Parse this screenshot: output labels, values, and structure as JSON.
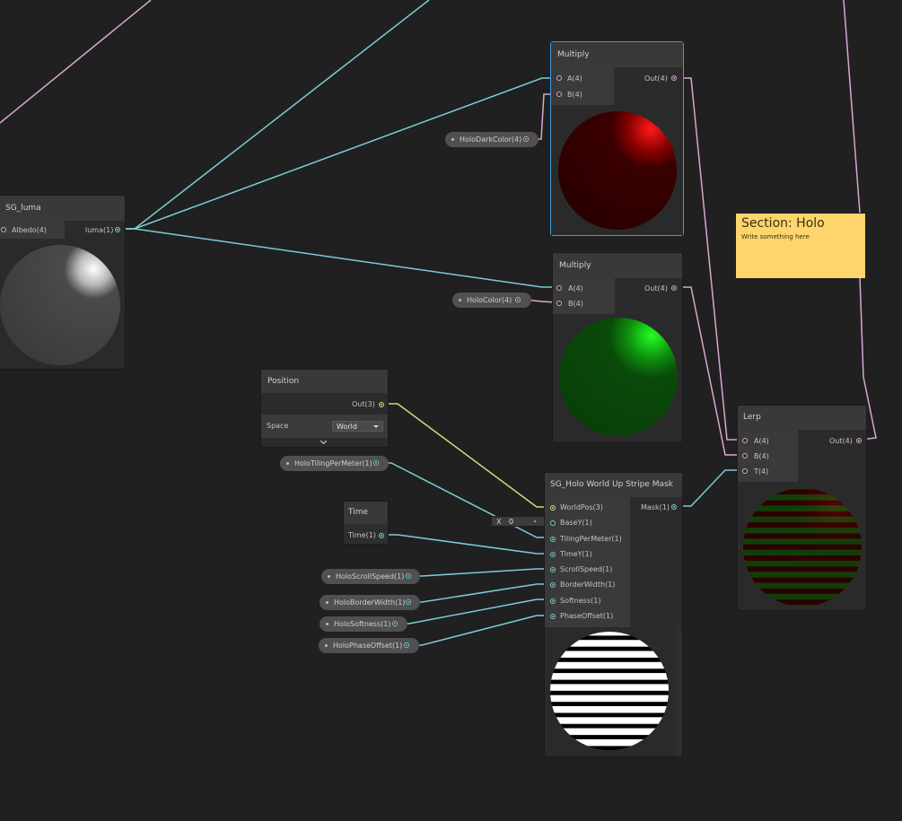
{
  "colors": {
    "background": "#202020",
    "wire_vector4": "#d9a6d3",
    "wire_float": "#7ccbd8",
    "wire_vector3": "#d6d97a",
    "sticky": "#fdd56c",
    "selection": "#3d9ae0"
  },
  "nodes": {
    "sg_luma": {
      "title": "SG_luma",
      "in_albedo": "Albedo(4)",
      "out_luma": "luma(1)"
    },
    "multiply_top": {
      "title": "Multiply",
      "in_a": "A(4)",
      "in_b": "B(4)",
      "out": "Out(4)"
    },
    "multiply_mid": {
      "title": "Multiply",
      "in_a": "A(4)",
      "in_b": "B(4)",
      "out": "Out(4)"
    },
    "position": {
      "title": "Position",
      "out": "Out(3)",
      "space_label": "Space",
      "space_value": "World",
      "expand_icon": "chevron-down-icon"
    },
    "time": {
      "title": "Time",
      "out": "Time(1)"
    },
    "stripe_mask": {
      "title": "SG_Holo World Up Stripe Mask",
      "inputs": [
        "WorldPos(3)",
        "BaseY(1)",
        "TilingPerMeter(1)",
        "TimeY(1)",
        "ScrollSpeed(1)",
        "BorderWidth(1)",
        "Softness(1)",
        "PhaseOffset(1)"
      ],
      "out": "Mask(1)",
      "basey_field_label": "X",
      "basey_field_value": "0"
    },
    "lerp": {
      "title": "Lerp",
      "in_a": "A(4)",
      "in_b": "B(4)",
      "in_t": "T(4)",
      "out": "Out(4)"
    }
  },
  "properties": {
    "holo_dark_color": "HoloDarkColor(4)",
    "holo_color": "HoloColor(4)",
    "holo_tiling_per_meter": "HoloTilingPerMeter(1)",
    "holo_scroll_speed": "HoloScrollSpeed(1)",
    "holo_border_width": "HoloBorderWidth(1)",
    "holo_softness": "HoloSoftness(1)",
    "holo_phase_offset": "HoloPhaseOffset(1)"
  },
  "sticky_note": {
    "title": "Section: Holo",
    "body": "Write something here"
  }
}
